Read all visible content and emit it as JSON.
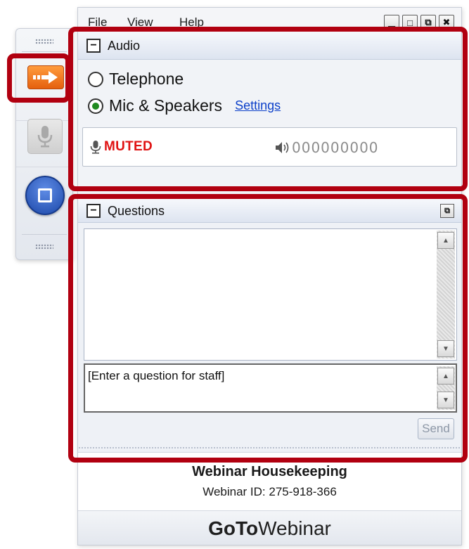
{
  "menu": {
    "file": "File",
    "view": "View",
    "help": "Help"
  },
  "window_controls": [
    {
      "name": "minimize",
      "glyph": "▁"
    },
    {
      "name": "maximize",
      "glyph": "□"
    },
    {
      "name": "restore",
      "glyph": "⧉"
    },
    {
      "name": "close",
      "glyph": "✖"
    }
  ],
  "audio": {
    "title": "Audio",
    "collapse_glyph": "−",
    "option_telephone": "Telephone",
    "option_mic": "Mic & Speakers",
    "selected": "Mic & Speakers",
    "settings_link": "Settings",
    "mic_status": "MUTED",
    "volume_level": "000000000",
    "colors": {
      "muted": "#e01313",
      "selected_radio": "#1f8a1f",
      "link": "#0b3fc9"
    }
  },
  "questions": {
    "title": "Questions",
    "collapse_glyph": "−",
    "input_text": "[Enter a question for staff]",
    "send_label": "Send"
  },
  "webinar": {
    "title": "Webinar Housekeeping",
    "id_line": "Webinar ID: 275-918-366"
  },
  "brand": {
    "bold_part": "GoTo",
    "light_part": "Webinar"
  },
  "colors": {
    "highlight": "#b10010",
    "arrow_button": "#e5600e",
    "stop_button": "#1b47a8"
  }
}
